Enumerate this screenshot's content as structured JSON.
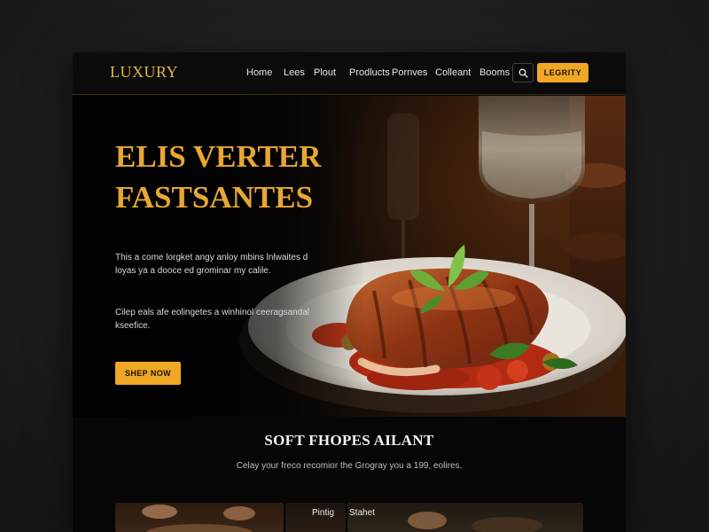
{
  "brand": {
    "logo": "LUXURY"
  },
  "nav": {
    "links": [
      "Home",
      "Lees",
      "Plout",
      "Prodlucts",
      "Pornves",
      "Colleant",
      "Booms"
    ],
    "cta_label": "LEGRITY"
  },
  "hero": {
    "title_line1": "ELIS VERTER",
    "title_line2": "FASTSANTES",
    "body": "This a come lorgket angy anloy mbins lnlwaites d loyas ya a dooce ed grominar my calile.",
    "body2": "Cilep eals afe eolingetes a winhinol ceeragsandal kseefice.",
    "cta_label": "SHEP NOW"
  },
  "section": {
    "title": "SOFT FHOPES AILANT",
    "body": "Celay your freco recomior the Grogray you a 199, eolires."
  },
  "cards": {
    "card2_label": "Pintig",
    "card3_label": "Stahet"
  },
  "colors": {
    "accent": "#f0a726",
    "title_gold": "#e8a733",
    "background": "#060606"
  },
  "icons": {
    "search": "search-icon"
  }
}
